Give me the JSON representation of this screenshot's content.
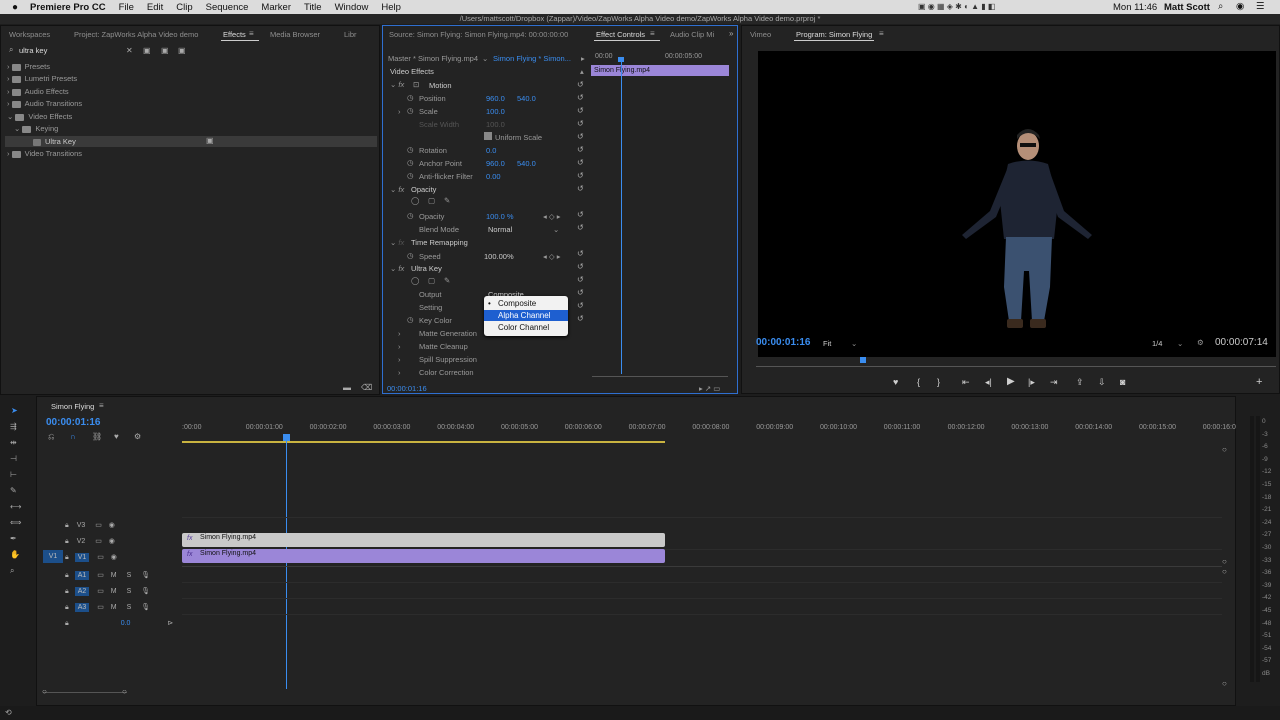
{
  "menubar": {
    "apple": "",
    "app": "Premiere Pro CC",
    "items": [
      "File",
      "Edit",
      "Clip",
      "Sequence",
      "Marker",
      "Title",
      "Window",
      "Help"
    ],
    "clock": "Mon 11:46",
    "user": "Matt Scott"
  },
  "titlebar": {
    "path": "/Users/mattscott/Dropbox (Zappar)/Video/ZapWorks Alpha Video demo/ZapWorks Alpha Video demo.prproj *"
  },
  "project_panel": {
    "tabs": [
      "Workspaces",
      "Project: ZapWorks Alpha Video demo",
      "Effects",
      "Media Browser",
      "Libr"
    ],
    "search_value": "ultra key",
    "tree": [
      "Presets",
      "Lumetri Presets",
      "Audio Effects",
      "Audio Transitions",
      "Video Effects",
      "Keying",
      "Ultra Key",
      "Video Transitions"
    ]
  },
  "effect_controls": {
    "tabs": [
      "Source: Simon Flying: Simon Flying.mp4: 00:00:00:00",
      "Effect Controls",
      "Audio Clip Mi"
    ],
    "master": "Master * Simon Flying.mp4",
    "sequence": "Simon Flying * Simon...",
    "section": "Video Effects",
    "timecode_ruler": [
      "00:00",
      "00:00:05:00"
    ],
    "clip_name": "Simon Flying.mp4",
    "rows": {
      "motion": "Motion",
      "position": "Position",
      "position_x": "960.0",
      "position_y": "540.0",
      "scale": "Scale",
      "scale_v": "100.0",
      "scale_width": "Scale Width",
      "scale_width_v": "100.0",
      "uniform": "Uniform Scale",
      "rotation": "Rotation",
      "rotation_v": "0.0",
      "anchor": "Anchor Point",
      "anchor_x": "960.0",
      "anchor_y": "540.0",
      "flicker": "Anti-flicker Filter",
      "flicker_v": "0.00",
      "opacity_hdr": "Opacity",
      "opacity": "Opacity",
      "opacity_v": "100.0 %",
      "blend": "Blend Mode",
      "blend_v": "Normal",
      "time_remap": "Time Remapping",
      "speed": "Speed",
      "speed_v": "100.00%",
      "ultra_key": "Ultra Key",
      "output": "Output",
      "output_v": "Composite",
      "setting": "Setting",
      "key_color": "Key Color",
      "matte_gen": "Matte Generation",
      "matte_clean": "Matte Cleanup",
      "spill": "Spill Suppression",
      "color_corr": "Color Correction"
    },
    "dropdown": [
      "Composite",
      "Alpha Channel",
      "Color Channel"
    ],
    "bottom_tc": "00:00:01:16"
  },
  "program_monitor": {
    "tabs": [
      "Vimeo",
      "Program: Simon Flying"
    ],
    "timecode": "00:00:01:16",
    "fit": "Fit",
    "resolution": "1/4",
    "duration": "00:00:07:14"
  },
  "timeline": {
    "tab": "Simon Flying",
    "timecode": "00:00:01:16",
    "ruler": [
      ":00:00",
      "00:00:01:00",
      "00:00:02:00",
      "00:00:03:00",
      "00:00:04:00",
      "00:00:05:00",
      "00:00:06:00",
      "00:00:07:00",
      "00:00:08:00",
      "00:00:09:00",
      "00:00:10:00",
      "00:00:11:00",
      "00:00:12:00",
      "00:00:13:00",
      "00:00:14:00",
      "00:00:15:00",
      "00:00:16:0"
    ],
    "tracks": [
      "V3",
      "V2",
      "V1",
      "A1",
      "A2",
      "A3"
    ],
    "src_v1": "V1",
    "master_vol": "0.0",
    "clip_v2": "Simon Flying.mp4",
    "clip_v1": "Simon Flying.mp4",
    "m": "M",
    "s": "S"
  },
  "meters": [
    "0",
    "-3",
    "-6",
    "-9",
    "-12",
    "-15",
    "-18",
    "-21",
    "-24",
    "-27",
    "-30",
    "-33",
    "-36",
    "-39",
    "-42",
    "-45",
    "-48",
    "-51",
    "-54",
    "-57",
    "dB"
  ],
  "colors": {
    "accent": "#3a8df0",
    "clip_purple": "#9b86d8",
    "clip_gray": "#c9c9c9",
    "selected": "#1e5fd0"
  }
}
